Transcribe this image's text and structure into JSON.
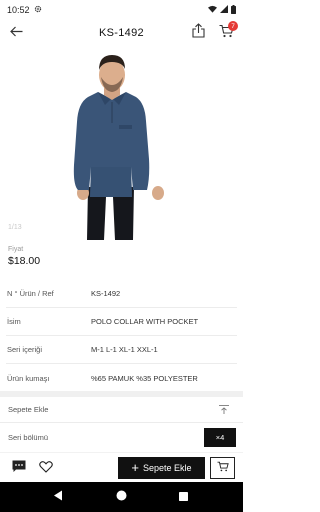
{
  "status_bar": {
    "time": "10:52",
    "icons": [
      "gear-icon",
      "wifi-icon",
      "signal-icon",
      "battery-icon"
    ]
  },
  "header": {
    "title": "KS-1492",
    "back_icon": "arrow-left-icon",
    "share_icon": "share-icon",
    "cart_icon": "cart-icon",
    "cart_badge": "7"
  },
  "gallery": {
    "counter": "1/13"
  },
  "price": {
    "label": "Fiyat",
    "value": "$18.00"
  },
  "specs": [
    {
      "label": "N ° Ürün / Ref",
      "value": "KS-1492"
    },
    {
      "label": "İsim",
      "value": "POLO COLLAR WITH POCKET"
    },
    {
      "label": "Seri içeriği",
      "value": "M-1 L-1 XL-1 XXL-1"
    },
    {
      "label": "Ürün kumaşı",
      "value": "%65 PAMUK %35 POLYESTER"
    }
  ],
  "accordions": {
    "add_to_cart_label": "Sepete Ekle",
    "series_label": "Seri bölümü",
    "series_qty": "×4"
  },
  "bottom_bar": {
    "add_button_label": "Sepete Ekle",
    "chat_icon": "chat-icon",
    "favorite_icon": "heart-icon",
    "mini_cart_icon": "cart-icon"
  },
  "colors": {
    "accent": "#111111",
    "badge": "#e53935",
    "sweater": "#3a5578"
  }
}
